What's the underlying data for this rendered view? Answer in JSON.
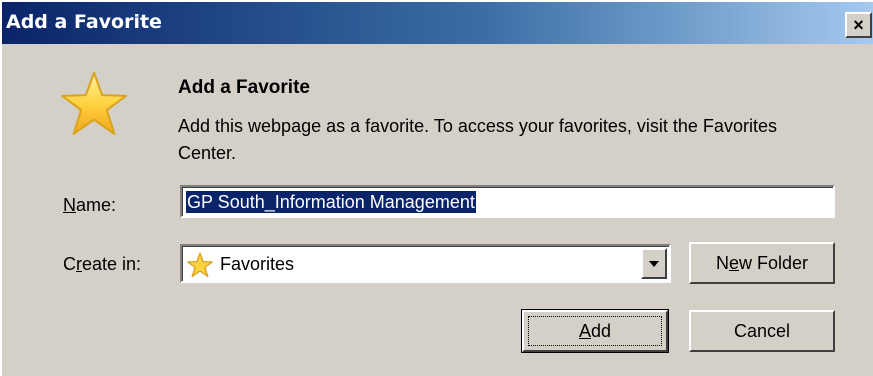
{
  "window": {
    "title": "Add a Favorite",
    "close_glyph": "×"
  },
  "header": {
    "heading": "Add a Favorite",
    "description": "Add this webpage as a favorite. To access your favorites, visit the Favorites Center."
  },
  "form": {
    "name_label": {
      "accel": "N",
      "rest": "ame:"
    },
    "name_value": "GP South_Information Management",
    "create_in_label": {
      "pre": "C",
      "accel": "r",
      "rest": "eate in:"
    },
    "create_in_value": "Favorites",
    "new_folder_button": {
      "pre": "N",
      "accel": "e",
      "rest": "w Folder"
    }
  },
  "buttons": {
    "add": {
      "accel": "A",
      "rest": "dd"
    },
    "cancel": "Cancel"
  },
  "icons": {
    "favorite_star": "star-icon",
    "dropdown_arrow": "chevron-down-icon"
  },
  "colors": {
    "titlebar_start": "#0a246a",
    "titlebar_end": "#a6caf0",
    "selection": "#0a246a",
    "face": "#d4d0c8",
    "star_fill": "#ffd23f",
    "star_stroke": "#d9a31f"
  }
}
